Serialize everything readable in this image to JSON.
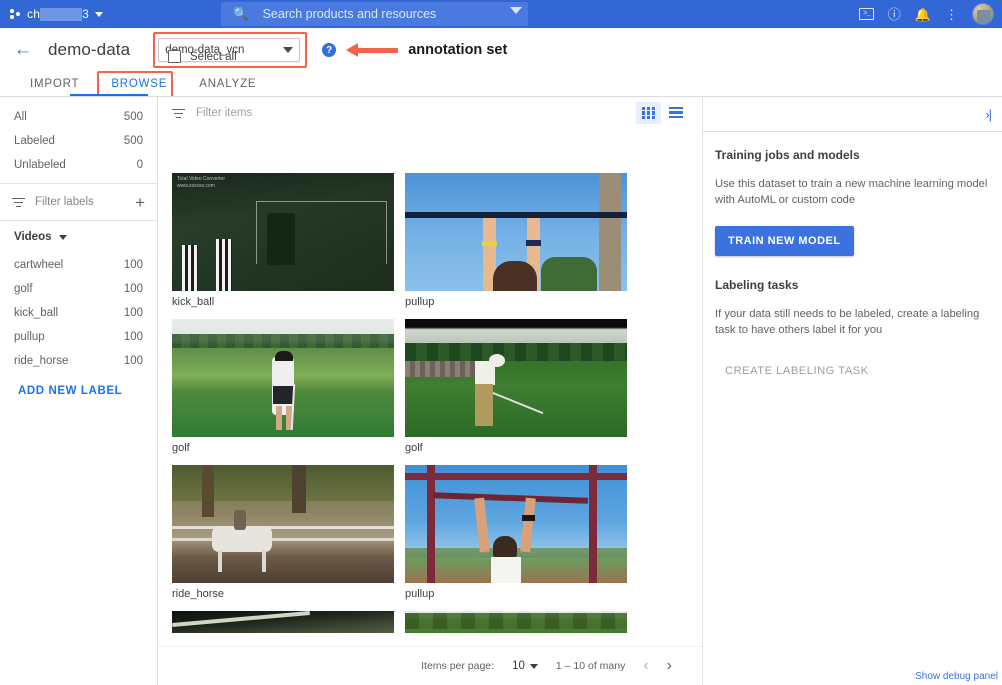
{
  "topbar": {
    "project_prefix": "ch",
    "project_suffix": "3",
    "search_placeholder": "Search products and resources",
    "icons": {
      "search": "search-icon",
      "expand": "chevron-down-icon",
      "shell": "cloud-shell-icon",
      "help": "help-icon",
      "notifications": "bell-icon",
      "more": "more-vert-icon",
      "avatar": "account-avatar"
    }
  },
  "header": {
    "back": "←",
    "dataset_title": "demo-data",
    "annotation_set_value": "demo-data_vcn",
    "help_glyph": "?",
    "callout_text": "annotation set"
  },
  "tabs": [
    {
      "label": "IMPORT",
      "active": false
    },
    {
      "label": "BROWSE",
      "active": true
    },
    {
      "label": "ANALYZE",
      "active": false
    }
  ],
  "sidebar": {
    "stats": [
      {
        "label": "All",
        "count": "500"
      },
      {
        "label": "Labeled",
        "count": "500"
      },
      {
        "label": "Unlabeled",
        "count": "0"
      }
    ],
    "filter_labels_placeholder": "Filter labels",
    "add_glyph": "+",
    "group_title": "Videos",
    "labels": [
      {
        "label": "cartwheel",
        "count": "100"
      },
      {
        "label": "golf",
        "count": "100"
      },
      {
        "label": "kick_ball",
        "count": "100"
      },
      {
        "label": "pullup",
        "count": "100"
      },
      {
        "label": "ride_horse",
        "count": "100"
      }
    ],
    "add_new_label": "ADD NEW LABEL"
  },
  "main": {
    "filter_items_placeholder": "Filter items",
    "select_all_label": "Select all",
    "view_grid": "grid-view-icon",
    "view_list": "list-view-icon",
    "items": [
      {
        "label": "kick_ball",
        "art": "th-kick"
      },
      {
        "label": "pullup",
        "art": "th-pullup1"
      },
      {
        "label": "golf",
        "art": "th-golf1"
      },
      {
        "label": "golf",
        "art": "th-golf2"
      },
      {
        "label": "ride_horse",
        "art": "th-horse"
      },
      {
        "label": "pullup",
        "art": "th-pullup2"
      },
      {
        "label": "",
        "art": "th-part1"
      },
      {
        "label": "",
        "art": "th-part2"
      }
    ]
  },
  "right_panel": {
    "collapse_glyph": "›|",
    "training_heading": "Training jobs and models",
    "training_body": "Use this dataset to train a new machine learning model with AutoML or custom code",
    "train_button": "TRAIN NEW MODEL",
    "labeling_heading": "Labeling tasks",
    "labeling_body": "If your data still needs to be labeled, create a labeling task to have others label it for you",
    "create_task_button": "CREATE LABELING TASK"
  },
  "paginator": {
    "items_per_page_label": "Items per page:",
    "items_per_page_value": "10",
    "range_text": "1 – 10 of many",
    "prev_glyph": "‹",
    "next_glyph": "›"
  },
  "footer": {
    "debug_link": "Show debug panel"
  },
  "colors": {
    "brand_blue": "#3367d6",
    "accent_blue": "#1a73e8",
    "button_blue": "#3b72e0",
    "highlight_red": "#f4624a",
    "text_primary": "#3c4043",
    "text_secondary": "#5f6368"
  }
}
